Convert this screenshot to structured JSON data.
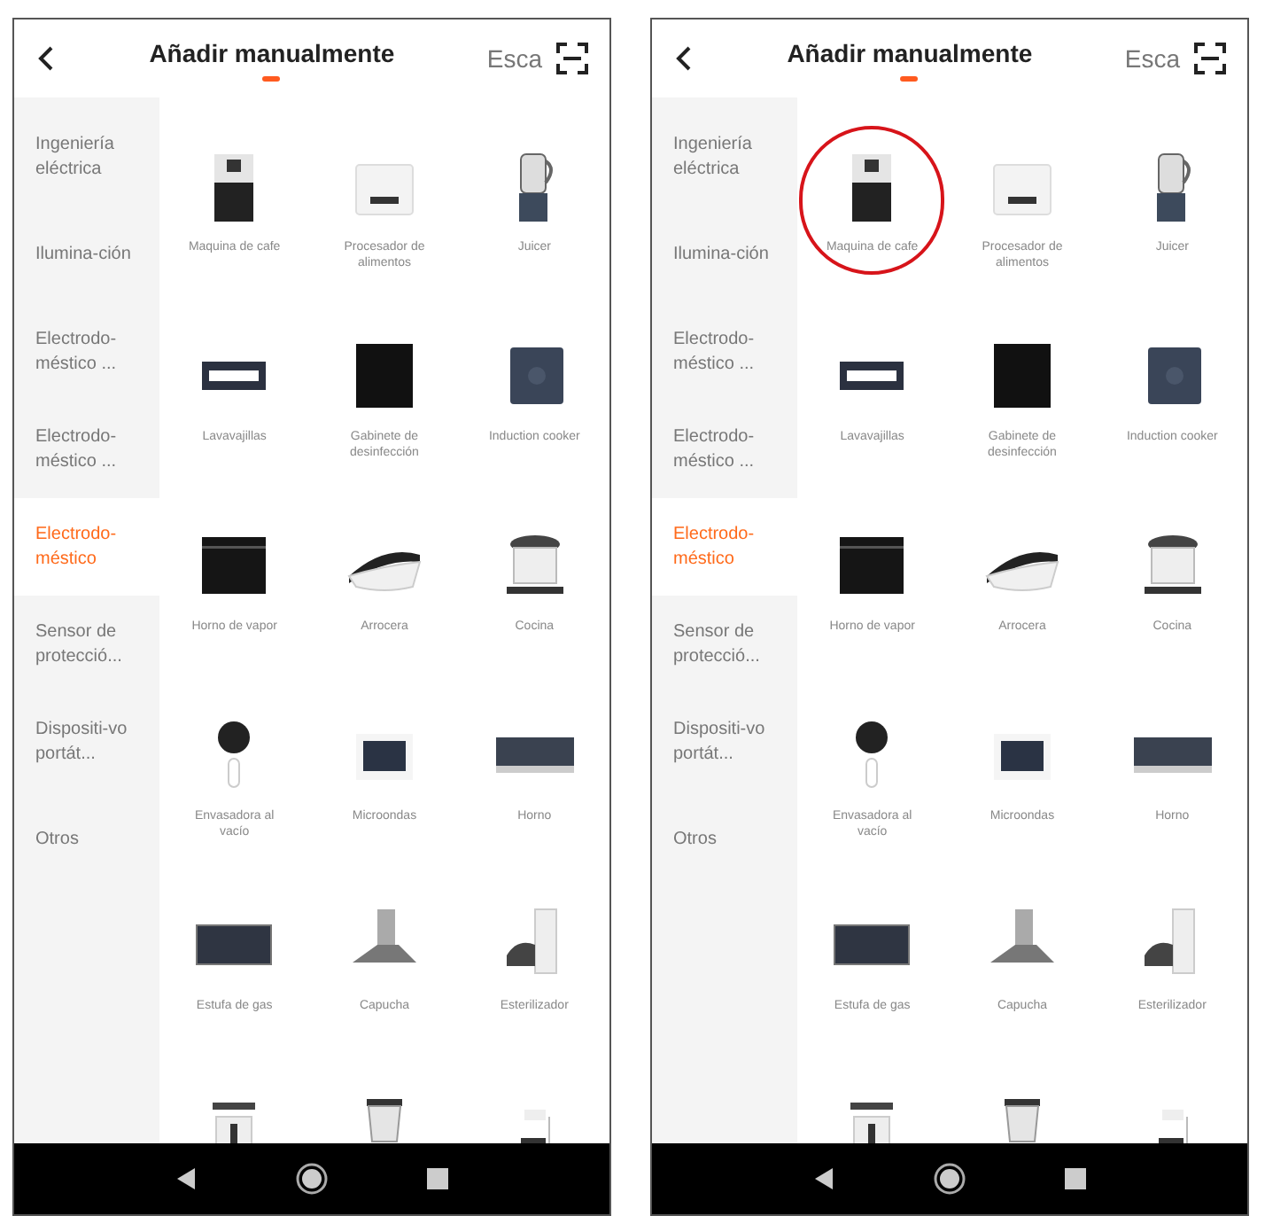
{
  "screens": [
    {
      "header": {
        "title": "Añadir manualmente",
        "scan_label": "Esca"
      },
      "categories": [
        {
          "label": "Ingeniería eléctrica",
          "selected": false
        },
        {
          "label": "Ilumina-ción",
          "selected": false
        },
        {
          "label": "Electrodo-méstico ...",
          "selected": false
        },
        {
          "label": "Electrodo-méstico ...",
          "selected": false
        },
        {
          "label": "Electrodo-méstico",
          "selected": true
        },
        {
          "label": "Sensor de protecció...",
          "selected": false
        },
        {
          "label": "Dispositi-vo portát...",
          "selected": false
        },
        {
          "label": "Otros",
          "selected": false
        }
      ],
      "devices": [
        {
          "kind": "coffee",
          "label": "Maquina de cafe",
          "circled": false
        },
        {
          "kind": "processor",
          "label": "Procesador de alimentos",
          "circled": false
        },
        {
          "kind": "juicer",
          "label": "Juicer",
          "circled": false
        },
        {
          "kind": "dishwasher",
          "label": "Lavavajillas",
          "circled": false
        },
        {
          "kind": "cabinet",
          "label": "Gabinete de desinfección",
          "circled": false
        },
        {
          "kind": "cooktop",
          "label": "Induction cooker",
          "circled": false
        },
        {
          "kind": "oven",
          "label": "Horno de vapor",
          "circled": false
        },
        {
          "kind": "rice",
          "label": "Arrocera",
          "circled": false
        },
        {
          "kind": "pot",
          "label": "Cocina",
          "circled": false
        },
        {
          "kind": "vacuum",
          "label": "Envasadora al vacío",
          "circled": false
        },
        {
          "kind": "microwave",
          "label": "Microondas",
          "circled": false
        },
        {
          "kind": "wideoven",
          "label": "Horno",
          "circled": false
        },
        {
          "kind": "gasstove",
          "label": "Estufa de gas",
          "circled": false
        },
        {
          "kind": "hood",
          "label": "Capucha",
          "circled": false
        },
        {
          "kind": "sterilizer",
          "label": "Esterilizador",
          "circled": false
        },
        {
          "kind": "scale",
          "circled": false
        },
        {
          "kind": "blender",
          "circled": false
        },
        {
          "kind": "kettle",
          "circled": false
        }
      ]
    },
    {
      "header": {
        "title": "Añadir manualmente",
        "scan_label": "Esca"
      },
      "categories": [
        {
          "label": "Ingeniería eléctrica",
          "selected": false
        },
        {
          "label": "Ilumina-ción",
          "selected": false
        },
        {
          "label": "Electrodo-méstico ...",
          "selected": false
        },
        {
          "label": "Electrodo-méstico ...",
          "selected": false
        },
        {
          "label": "Electrodo-méstico",
          "selected": true
        },
        {
          "label": "Sensor de protecció...",
          "selected": false
        },
        {
          "label": "Dispositi-vo portát...",
          "selected": false
        },
        {
          "label": "Otros",
          "selected": false
        }
      ],
      "devices": [
        {
          "kind": "coffee",
          "label": "Maquina de cafe",
          "circled": true
        },
        {
          "kind": "processor",
          "label": "Procesador de alimentos",
          "circled": false
        },
        {
          "kind": "juicer",
          "label": "Juicer",
          "circled": false
        },
        {
          "kind": "dishwasher",
          "label": "Lavavajillas",
          "circled": false
        },
        {
          "kind": "cabinet",
          "label": "Gabinete de desinfección",
          "circled": false
        },
        {
          "kind": "cooktop",
          "label": "Induction cooker",
          "circled": false
        },
        {
          "kind": "oven",
          "label": "Horno de vapor",
          "circled": false
        },
        {
          "kind": "rice",
          "label": "Arrocera",
          "circled": false
        },
        {
          "kind": "pot",
          "label": "Cocina",
          "circled": false
        },
        {
          "kind": "vacuum",
          "label": "Envasadora al vacío",
          "circled": false
        },
        {
          "kind": "microwave",
          "label": "Microondas",
          "circled": false
        },
        {
          "kind": "wideoven",
          "label": "Horno",
          "circled": false
        },
        {
          "kind": "gasstove",
          "label": "Estufa de gas",
          "circled": false
        },
        {
          "kind": "hood",
          "label": "Capucha",
          "circled": false
        },
        {
          "kind": "sterilizer",
          "label": "Esterilizador",
          "circled": false
        },
        {
          "kind": "scale",
          "circled": false
        },
        {
          "kind": "blender",
          "circled": false
        },
        {
          "kind": "kettle",
          "circled": false
        }
      ]
    }
  ]
}
